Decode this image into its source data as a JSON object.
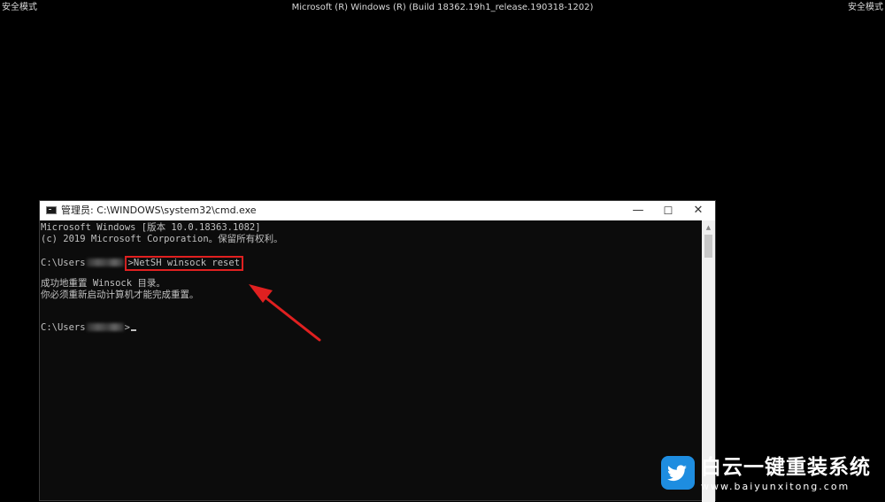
{
  "desktop": {
    "safe_mode_left": "安全模式",
    "safe_mode_right": "安全模式",
    "build_info": "Microsoft (R) Windows (R) (Build 18362.19h1_release.190318-1202)"
  },
  "window": {
    "title": "管理员: C:\\WINDOWS\\system32\\cmd.exe",
    "icon": "cmd-icon",
    "buttons": {
      "minimize": "—",
      "maximize": "☐",
      "close": "✕"
    }
  },
  "console": {
    "line1": "Microsoft Windows [版本 10.0.18363.1082]",
    "line2": "(c) 2019 Microsoft Corporation。保留所有权利。",
    "prompt_prefix": "C:\\Users",
    "prompt_suffix": ">",
    "command": "NetSH winsock reset",
    "result1": "成功地重置 Winsock 目录。",
    "result2": "你必须重新启动计算机才能完成重置。"
  },
  "annotations": {
    "highlight_color": "#e02020",
    "arrow_color": "#e02020"
  },
  "watermark": {
    "title": "白云一键重装系统",
    "url": "www.baiyunxitong.com",
    "logo": "twitter-bird-icon",
    "logo_color": "#1e8de0"
  }
}
